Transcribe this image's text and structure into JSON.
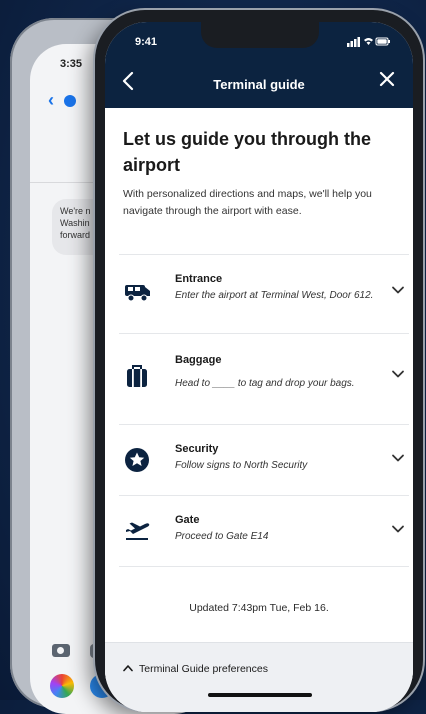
{
  "back_phone": {
    "time": "3:35",
    "message_preview": "We're n\nWashin\nforward"
  },
  "status_bar": {
    "time": "9:41",
    "icons": "signal-wifi-battery"
  },
  "nav": {
    "title": "Terminal guide",
    "back_icon": "chevron-left-icon",
    "close_icon": "close-icon"
  },
  "intro": {
    "headline": "Let us guide you through the airport",
    "subtext": "With personalized directions and maps, we'll help you navigate through the airport with ease."
  },
  "steps": [
    {
      "icon": "bus-icon",
      "title": "Entrance",
      "description": "Enter the airport at Terminal West, Door 612."
    },
    {
      "icon": "baggage-icon",
      "title": "Baggage",
      "description": "Head to ____ to tag and drop your bags."
    },
    {
      "icon": "security-star-icon",
      "title": "Security",
      "description": "Follow signs to North Security"
    },
    {
      "icon": "airplane-departure-icon",
      "title": "Gate",
      "description": "Proceed to Gate E14"
    }
  ],
  "updated": "Updated  7:43pm Tue, Feb 16.",
  "footer": {
    "preferences_label": "Terminal Guide preferences"
  },
  "colors": {
    "navy": "#0c2340",
    "background": "#0f2548"
  }
}
